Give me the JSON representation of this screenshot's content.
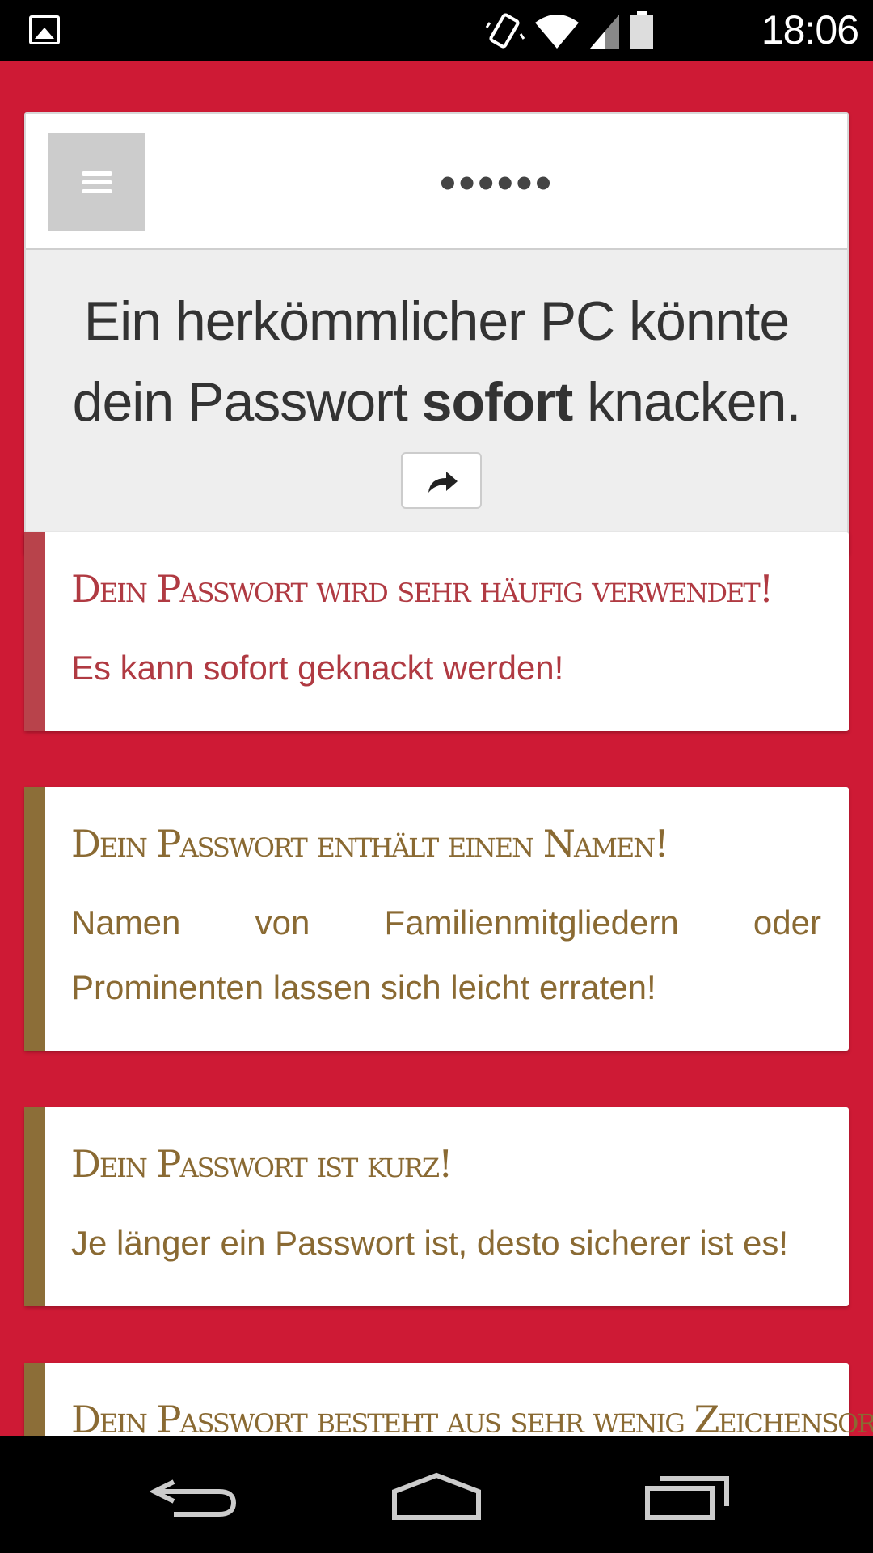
{
  "status_bar": {
    "time": "18:06",
    "icons": [
      "gallery-icon",
      "vibrate-icon",
      "wifi-icon",
      "signal-icon",
      "battery-icon"
    ]
  },
  "password_field": {
    "masked_value": "••••••"
  },
  "crack_message": {
    "prefix": "Ein herkömmlicher PC könnte dein Passwort ",
    "emphasis": "sofort",
    "suffix": " knacken."
  },
  "alerts": [
    {
      "title": "Dein Passwort wird sehr häufig verwendet!",
      "text": "Es kann sofort geknackt werden!",
      "severity": "danger",
      "color": "#b03a42"
    },
    {
      "title": "Dein Passwort enthält einen Namen!",
      "text": "Namen von Familienmitgliedern oder Prominenten lassen sich leicht erraten!",
      "severity": "warning",
      "color": "#8a6a33"
    },
    {
      "title": "Dein Passwort ist kurz!",
      "text": "Je länger ein Passwort ist, desto sicherer ist es!",
      "severity": "warning",
      "color": "#8a6a33"
    },
    {
      "title": "Dein Passwort besteht aus sehr wenig Zeichensorten!",
      "text": "",
      "severity": "warning",
      "color": "#8a6a33"
    }
  ],
  "colors": {
    "background": "#CE1A35",
    "danger": "#b03a42",
    "warning": "#8a6a33"
  },
  "nav_bar": {
    "buttons": [
      "back-icon",
      "home-icon",
      "recents-icon"
    ]
  }
}
